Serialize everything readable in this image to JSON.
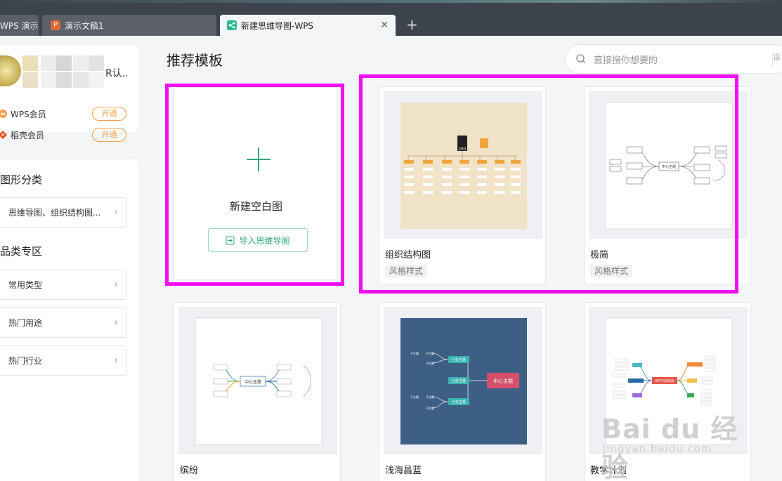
{
  "tabs": [
    {
      "label": "WPS 演示"
    },
    {
      "label": "演示文稿1"
    },
    {
      "label": "新建思维导图-WPS"
    }
  ],
  "sidebar": {
    "user_name": "R认..",
    "memberships": [
      {
        "label": "WPS会员",
        "button": "开通"
      },
      {
        "label": "稻壳会员",
        "button": "开通"
      }
    ],
    "graphic_category_title": "图形分类",
    "graphic_category_item": "思维导图、组织结构图...",
    "product_area_title": "品类专区",
    "product_area_items": [
      "常用类型",
      "热门用途",
      "热门行业"
    ]
  },
  "main": {
    "title": "推荐模板",
    "search_placeholder": "直接搜你想要的",
    "search_end": "设",
    "new_card": {
      "label": "新建空白图",
      "import_label": "导入思维导图"
    },
    "templates": [
      {
        "title": "组织结构图",
        "tag": "风格样式"
      },
      {
        "title": "极简",
        "tag": "风格样式"
      },
      {
        "title": "缤纷"
      },
      {
        "title": "浅海昌蓝"
      },
      {
        "title": "教学计划"
      }
    ],
    "thumb_text": {
      "ceo": "CEO",
      "center_topic": "中心主题",
      "branch_topic": "分支主题",
      "sub_topic": "子主题",
      "teaching_center": "教学内容规划"
    }
  },
  "watermark": {
    "big": "Bai du 经验",
    "small": "jingyan.baidu.com"
  },
  "colors": {
    "accent_green": "#2ea57a",
    "highlight_magenta": "#f20df2",
    "member_orange": "#f0a14a",
    "tabbar": "#3d434d",
    "ocean_blue": "#3d5f84",
    "ocean_center": "#d4506a",
    "ocean_teal": "#3bb3b0"
  },
  "icons": [
    "search-icon",
    "plus-icon",
    "import-icon",
    "crown-icon",
    "chevron-right-icon",
    "close-icon"
  ]
}
